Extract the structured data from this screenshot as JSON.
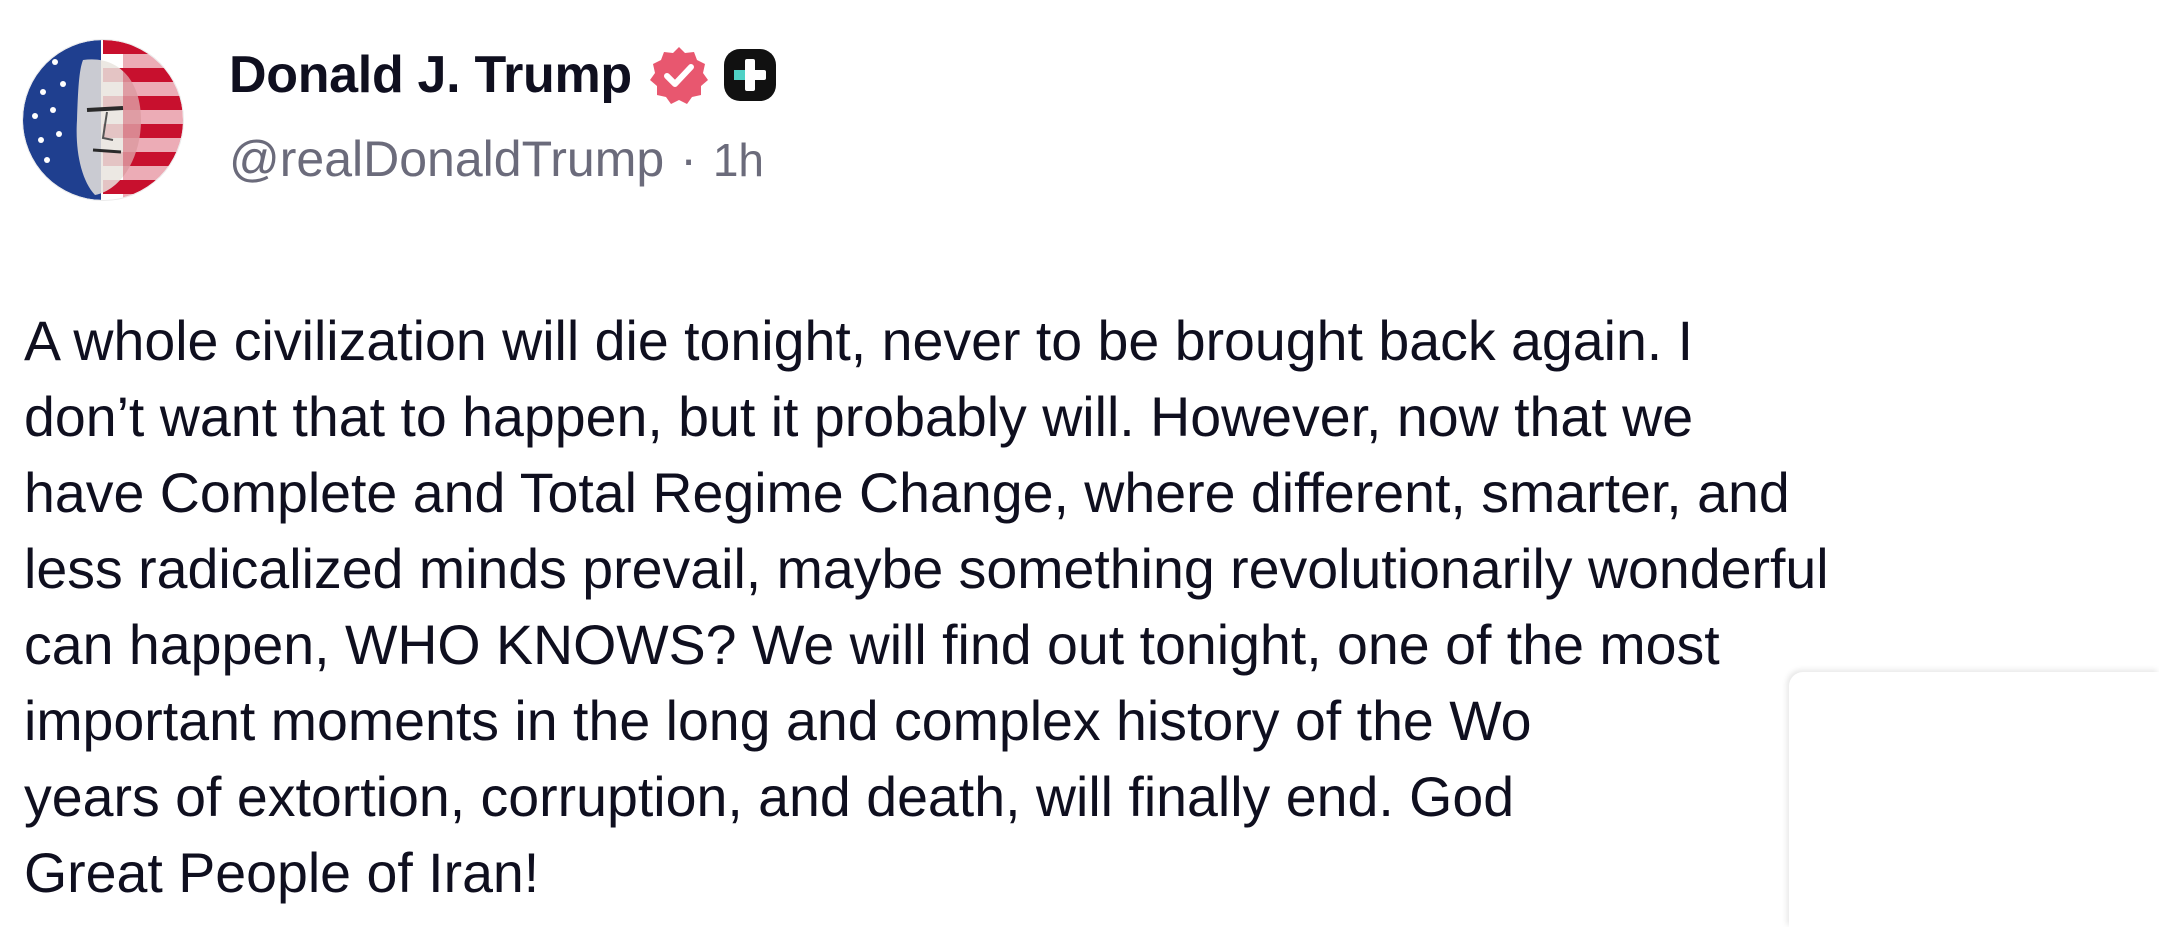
{
  "author": {
    "display_name": "Donald J. Trump",
    "handle": "@realDonaldTrump",
    "separator": "·",
    "time_ago": "1h",
    "avatar_icon": "flag-portrait-avatar",
    "verified_icon": "verified-badge-icon",
    "plus_icon": "plus-badge-icon"
  },
  "post": {
    "lines": [
      "A whole civilization will die tonight, never to be brought back again. I",
      "don’t want that to happen, but it probably will. However, now that we",
      "have Complete and Total Regime Change, where different, smarter, and",
      "less radicalized minds prevail, maybe something revolutionarily wonderful",
      "can happen, WHO KNOWS? We will find out tonight, one of the most",
      "important moments in the long and complex history of the Wo",
      "years of extortion, corruption, and death, will finally end. God",
      "Great People of Iran!"
    ]
  },
  "colors": {
    "text": "#0f0f1f",
    "muted": "#6b6b7b",
    "verified": "#e8576f",
    "plus_badge_bg": "#111111",
    "plus_badge_accent": "#4fd1c5"
  }
}
